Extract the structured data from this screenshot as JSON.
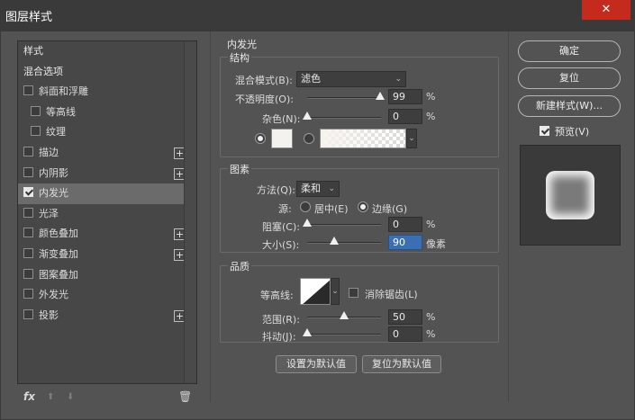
{
  "window": {
    "title": "图层样式",
    "close_glyph": "✕"
  },
  "styles_panel": {
    "header": "样式",
    "blend_options": "混合选项",
    "items": [
      {
        "label": "斜面和浮雕",
        "checked": false,
        "has_plus": false,
        "indent": false
      },
      {
        "label": "等高线",
        "checked": false,
        "has_plus": false,
        "indent": true
      },
      {
        "label": "纹理",
        "checked": false,
        "has_plus": false,
        "indent": true
      },
      {
        "label": "描边",
        "checked": false,
        "has_plus": true,
        "indent": false
      },
      {
        "label": "内阴影",
        "checked": false,
        "has_plus": true,
        "indent": false
      },
      {
        "label": "内发光",
        "checked": true,
        "has_plus": false,
        "indent": false,
        "active": true
      },
      {
        "label": "光泽",
        "checked": false,
        "has_plus": false,
        "indent": false
      },
      {
        "label": "颜色叠加",
        "checked": false,
        "has_plus": true,
        "indent": false
      },
      {
        "label": "渐变叠加",
        "checked": false,
        "has_plus": true,
        "indent": false
      },
      {
        "label": "图案叠加",
        "checked": false,
        "has_plus": false,
        "indent": false
      },
      {
        "label": "外发光",
        "checked": false,
        "has_plus": false,
        "indent": false
      },
      {
        "label": "投影",
        "checked": false,
        "has_plus": true,
        "indent": false
      }
    ],
    "plus_glyph": "+",
    "footer": {
      "fx": "fx",
      "up_glyph": "⬆",
      "down_glyph": "⬇",
      "trash_glyph": "🗑"
    }
  },
  "inner_glow": {
    "title": "内发光",
    "structure": {
      "legend": "结构",
      "blend_mode_label": "混合模式(B):",
      "blend_mode_value": "滤色",
      "opacity_label": "不透明度(O):",
      "opacity_value": "99",
      "noise_label": "杂色(N):",
      "noise_value": "0",
      "percent": "%"
    },
    "elements": {
      "legend": "图素",
      "technique_label": "方法(Q):",
      "technique_value": "柔和",
      "source_label": "源:",
      "center_label": "居中(E)",
      "edge_label": "边缘(G)",
      "choke_label": "阻塞(C):",
      "choke_value": "0",
      "size_label": "大小(S):",
      "size_value": "90",
      "size_unit": "像素",
      "percent": "%"
    },
    "quality": {
      "legend": "品质",
      "contour_label": "等高线:",
      "anti_alias_label": "消除锯齿(L)",
      "range_label": "范围(R):",
      "range_value": "50",
      "jitter_label": "抖动(J):",
      "jitter_value": "0",
      "percent": "%"
    },
    "set_default": "设置为默认值",
    "reset_default": "复位为默认值"
  },
  "right": {
    "ok": "确定",
    "reset": "复位",
    "new_style": "新建样式(W)...",
    "preview_label": "预览(V)"
  },
  "levels": {
    "opacity": 0.99,
    "noise": 0,
    "choke": 0,
    "size": 0.36,
    "range": 0.5,
    "jitter": 0
  },
  "colors": {
    "selection": "#3a6fb3",
    "close": "#c42b1c",
    "glow": "#f4f2ef"
  }
}
